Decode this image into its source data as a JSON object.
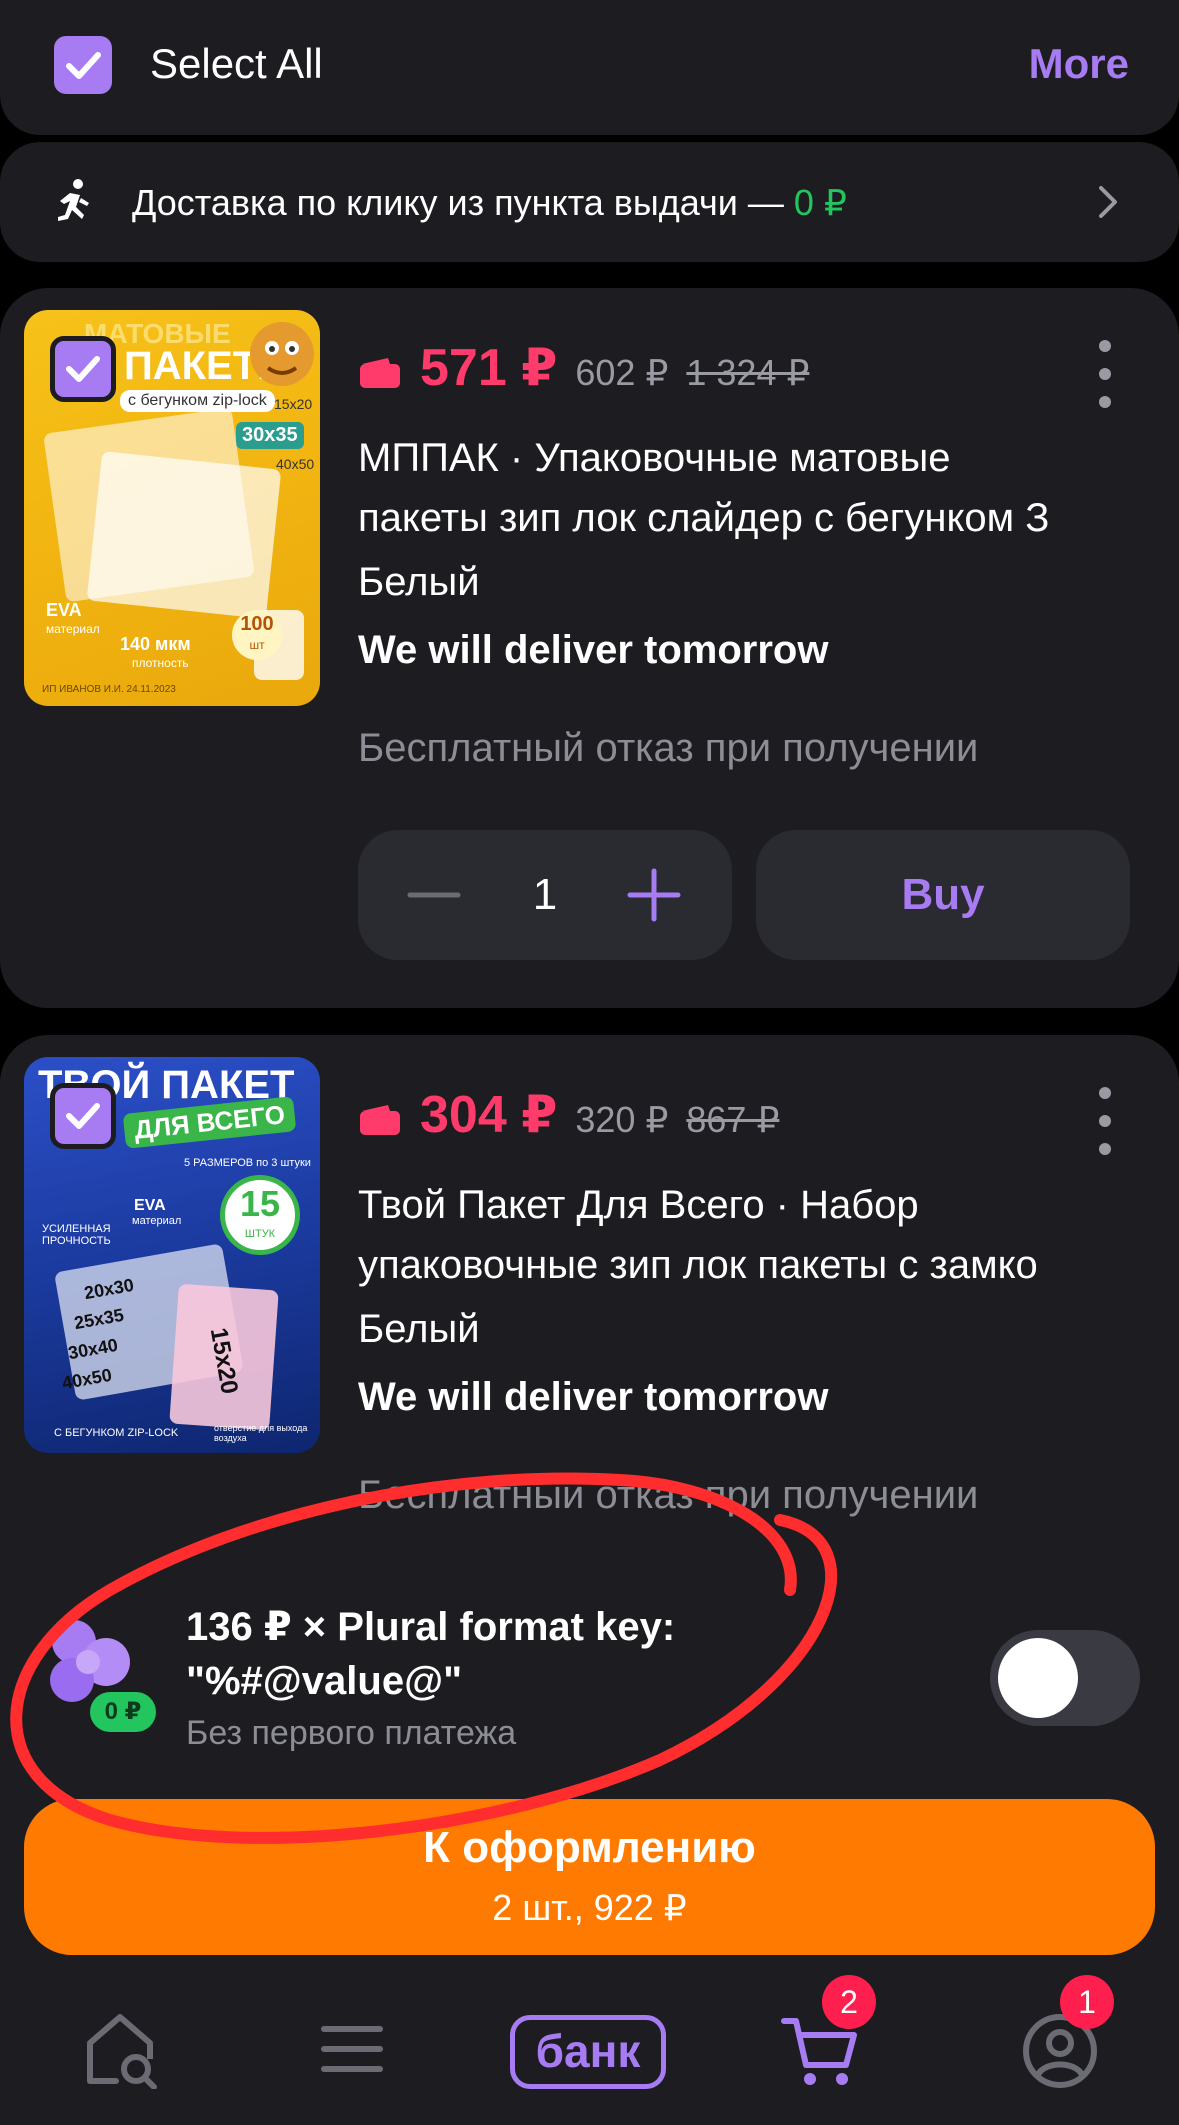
{
  "header": {
    "select_all_label": "Select All",
    "more_label": "More"
  },
  "delivery_banner": {
    "text": "Доставка по клику из пункта выдачи —",
    "price": "0 ₽"
  },
  "products": [
    {
      "price": "571 ₽",
      "price_mid": "602 ₽",
      "price_old": "1 324 ₽",
      "title_line1": "МППАК · Упаковочные матовые",
      "title_line2": "пакеты зип лок слайдер с бегунком З",
      "color": "Белый",
      "delivery": "We will deliver tomorrow",
      "return_policy": "Бесплатный отказ при получении",
      "quantity": "1",
      "buy_label": "Buy",
      "image_text": {
        "line1": "МАТОВЫЕ",
        "line2": "ПАКЕТЫ",
        "line3": "с бегунком zip-lock",
        "size1": "15x20",
        "size2": "30x35",
        "size3": "40x50",
        "eva": "EVA",
        "eva_sub": "материал",
        "thickness": "140 мкм",
        "thickness_sub": "плотность",
        "count": "100",
        "count_sub": "шт",
        "footer": "ИП ИВАНОВ И.И. 24.11.2023"
      }
    },
    {
      "price": "304 ₽",
      "price_mid": "320 ₽",
      "price_old": "867 ₽",
      "title_line1": "Твой Пакет Для Всего · Набор",
      "title_line2": "упаковочные зип лок пакеты с замко",
      "color": "Белый",
      "delivery": "We will deliver tomorrow",
      "return_policy": "Бесплатный отказ при получении",
      "image_text": {
        "line1": "ТВОЙ ПАКЕТ",
        "line2": "ДЛЯ ВСЕГО",
        "sizes_note": "5 РАЗМЕРОВ по 3 штуки",
        "count": "15",
        "count_sub": "ШТУК",
        "feature1": "УСИЛЕННАЯ ПРОЧНОСТЬ",
        "feature2": "EVA",
        "feature2_sub": "материал",
        "size1": "20x30",
        "size2": "25x35",
        "size3": "30x40",
        "size4": "40x50",
        "size5": "15x20",
        "footer": "С БЕГУНКОМ ZIP-LOCK",
        "footer_note": "отверстие для выхода воздуха"
      }
    }
  ],
  "installment": {
    "line1": "136 ₽ × Plural format key:",
    "line2": "\"%#@value@\"",
    "subtitle": "Без первого платежа",
    "badge": "0 ₽",
    "enabled": false
  },
  "checkout": {
    "title": "К оформлению",
    "subtitle": "2 шт., 922 ₽"
  },
  "nav": {
    "bank_label": "банк",
    "cart_badge": "2",
    "profile_badge": "1",
    "icons": [
      "home-search-icon",
      "menu-icon",
      "bank-logo",
      "cart-icon",
      "profile-icon"
    ]
  },
  "colors": {
    "accent": "#a77cf2",
    "price": "#ff3b6b",
    "success": "#22c55e",
    "checkout": "#ff7a00",
    "badge": "#ff1f4e",
    "annotation": "#ff2d2d"
  }
}
